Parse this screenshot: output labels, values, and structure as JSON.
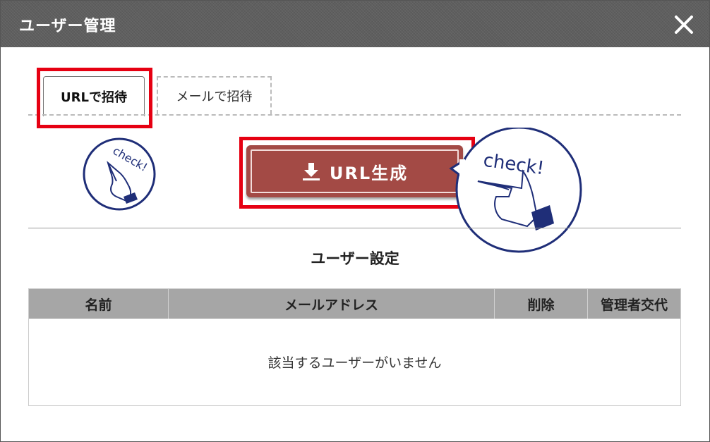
{
  "modal": {
    "title": "ユーザー管理",
    "close_icon": "close-icon"
  },
  "tabs": [
    {
      "label": "URLで招待",
      "active": true
    },
    {
      "label": "メールで招待",
      "active": false
    }
  ],
  "generate_button": {
    "label": "URL生成",
    "icon": "download-icon",
    "color": "#a34a45"
  },
  "check_stamp": {
    "text": "check!"
  },
  "highlight_color": "#e60012",
  "user_settings": {
    "title": "ユーザー設定",
    "columns": [
      "名前",
      "メールアドレス",
      "削除",
      "管理者交代"
    ],
    "empty_message": "該当するユーザーがいません"
  }
}
